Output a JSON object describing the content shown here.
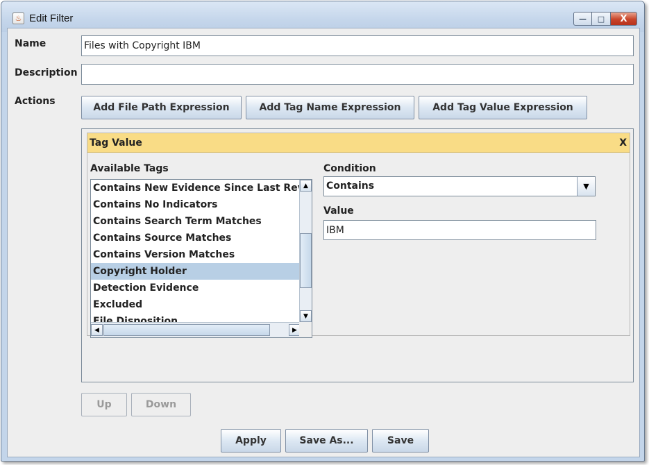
{
  "window": {
    "title": "Edit Filter",
    "controls": {
      "minimize": "—",
      "maximize": "□",
      "close": "X"
    }
  },
  "form": {
    "name_label": "Name",
    "name_value": "Files with Copyright IBM",
    "description_label": "Description",
    "description_value": "",
    "actions_label": "Actions"
  },
  "actions": {
    "add_file_path": "Add File Path Expression",
    "add_tag_name": "Add Tag Name Expression",
    "add_tag_value": "Add Tag Value Expression"
  },
  "tag_value_panel": {
    "title": "Tag Value",
    "close_label": "X",
    "available_tags_label": "Available Tags",
    "available_tags": [
      "Contains New Evidence Since Last Review",
      "Contains No Indicators",
      "Contains Search Term Matches",
      "Contains Source Matches",
      "Contains Version Matches",
      "Copyright Holder",
      "Detection Evidence",
      "Excluded",
      "File Disposition"
    ],
    "selected_tag": "Copyright Holder",
    "condition_label": "Condition",
    "condition_value": "Contains",
    "value_label": "Value",
    "value": "IBM"
  },
  "order_buttons": {
    "up": "Up",
    "down": "Down",
    "enabled": false
  },
  "footer": {
    "apply": "Apply",
    "save_as": "Save As...",
    "save": "Save"
  },
  "colors": {
    "header_bar": "#f9dc86",
    "selection": "#b8cfe5",
    "window_frame": "#c3d5ea"
  },
  "icons": {
    "app": "java-cup-icon",
    "combo_arrow": "chevron-down-icon",
    "scroll_up": "arrow-up-icon",
    "scroll_down": "arrow-down-icon",
    "scroll_left": "arrow-left-icon",
    "scroll_right": "arrow-right-icon"
  }
}
